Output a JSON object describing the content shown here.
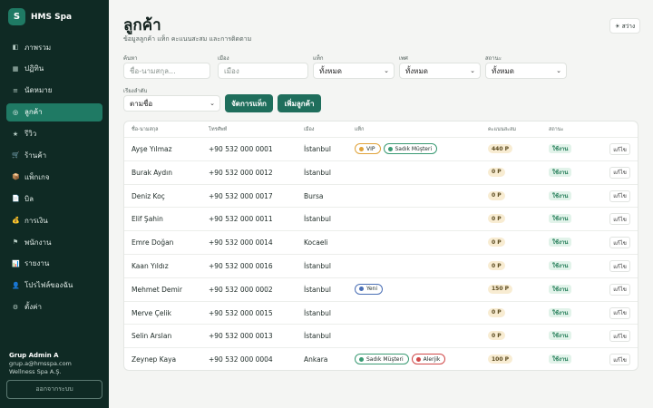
{
  "brand": {
    "logo_letter": "S",
    "name": "HMS Spa"
  },
  "nav": [
    {
      "label": "ภาพรวม",
      "icon": "◧",
      "name": "dashboard"
    },
    {
      "label": "ปฏิทิน",
      "icon": "▦",
      "name": "calendar"
    },
    {
      "label": "นัดหมาย",
      "icon": "≡",
      "name": "appointments"
    },
    {
      "label": "ลูกค้า",
      "icon": "◎",
      "name": "customers"
    },
    {
      "label": "รีวิว",
      "icon": "★",
      "name": "reviews"
    },
    {
      "label": "ร้านค้า",
      "icon": "🛒",
      "name": "shop"
    },
    {
      "label": "แพ็กเกจ",
      "icon": "📦",
      "name": "packages"
    },
    {
      "label": "บิล",
      "icon": "📄",
      "name": "bills"
    },
    {
      "label": "การเงิน",
      "icon": "💰",
      "name": "finance"
    },
    {
      "label": "พนักงาน",
      "icon": "⚑",
      "name": "staff"
    },
    {
      "label": "รายงาน",
      "icon": "📊",
      "name": "reports"
    },
    {
      "label": "โปรไฟล์ของฉัน",
      "icon": "👤",
      "name": "my-profile"
    },
    {
      "label": "ตั้งค่า",
      "icon": "⚙",
      "name": "settings"
    }
  ],
  "active_nav": 3,
  "user": {
    "name": "Grup Admin A",
    "email": "grup.a@hmsspa.com",
    "company": "Wellness Spa A.Ş."
  },
  "logout_label": "ออกจากระบบ",
  "page": {
    "title": "ลูกค้า",
    "subtitle": "ข้อมูลลูกค้า แท็ก คะแนนสะสม และการติดตาม"
  },
  "theme_toggle": {
    "icon": "☀",
    "label": "สว่าง"
  },
  "filters": {
    "search": {
      "label": "ค้นหา",
      "placeholder": "ชื่อ-นามสกุล..."
    },
    "city": {
      "label": "เมือง",
      "placeholder": "เมือง"
    },
    "tag": {
      "label": "แท็ก",
      "value": "ทั้งหมด"
    },
    "gender": {
      "label": "เพศ",
      "value": "ทั้งหมด"
    },
    "status": {
      "label": "สถานะ",
      "value": "ทั้งหมด"
    },
    "sort": {
      "label": "เรียงลำดับ",
      "value": "ตามชื่อ"
    }
  },
  "buttons": {
    "manage_tags": "จัดการแท็ก",
    "add_customer": "เพิ่มลูกค้า"
  },
  "table": {
    "headers": {
      "name": "ชื่อ-นามสกุล",
      "phone": "โทรศัพท์",
      "city": "เมือง",
      "tags": "แท็ก",
      "points": "คะแนนสะสม",
      "status": "สถานะ"
    },
    "edit_label": "แก้ไข",
    "rows": [
      {
        "name": "Ayşe Yılmaz",
        "phone": "+90 532 000 0001",
        "city": "İstanbul",
        "tags": [
          "VIP",
          "Sadık Müşteri"
        ],
        "points": "440 P",
        "status": "ใช้งาน"
      },
      {
        "name": "Burak Aydın",
        "phone": "+90 532 000 0012",
        "city": "İstanbul",
        "tags": [],
        "points": "0 P",
        "status": "ใช้งาน"
      },
      {
        "name": "Deniz Koç",
        "phone": "+90 532 000 0017",
        "city": "Bursa",
        "tags": [],
        "points": "0 P",
        "status": "ใช้งาน"
      },
      {
        "name": "Elif Şahin",
        "phone": "+90 532 000 0011",
        "city": "İstanbul",
        "tags": [],
        "points": "0 P",
        "status": "ใช้งาน"
      },
      {
        "name": "Emre Doğan",
        "phone": "+90 532 000 0014",
        "city": "Kocaeli",
        "tags": [],
        "points": "0 P",
        "status": "ใช้งาน"
      },
      {
        "name": "Kaan Yıldız",
        "phone": "+90 532 000 0016",
        "city": "İstanbul",
        "tags": [],
        "points": "0 P",
        "status": "ใช้งาน"
      },
      {
        "name": "Mehmet Demir",
        "phone": "+90 532 000 0002",
        "city": "İstanbul",
        "tags": [
          "Yeni"
        ],
        "points": "150 P",
        "status": "ใช้งาน"
      },
      {
        "name": "Merve Çelik",
        "phone": "+90 532 000 0015",
        "city": "İstanbul",
        "tags": [],
        "points": "0 P",
        "status": "ใช้งาน"
      },
      {
        "name": "Selin Arslan",
        "phone": "+90 532 000 0013",
        "city": "İstanbul",
        "tags": [],
        "points": "0 P",
        "status": "ใช้งาน"
      },
      {
        "name": "Zeynep Kaya",
        "phone": "+90 532 000 0004",
        "city": "Ankara",
        "tags": [
          "Sadık Müşteri",
          "Alerjik"
        ],
        "points": "100 P",
        "status": "ใช้งาน"
      }
    ]
  },
  "tag_colors": {
    "VIP": {
      "border": "#e0a33a",
      "dot": "#e0a33a"
    },
    "Sadık Müşteri": {
      "border": "#3a9a73",
      "dot": "#3a9a73"
    },
    "Yeni": {
      "border": "#4a6fb5",
      "dot": "#4a6fb5"
    },
    "Alerjik": {
      "border": "#d04848",
      "dot": "#d04848"
    }
  },
  "colors": {
    "sidebar_bg": "#0f2a24",
    "accent": "#1f7a64",
    "primary_button": "#1f6e5c"
  }
}
